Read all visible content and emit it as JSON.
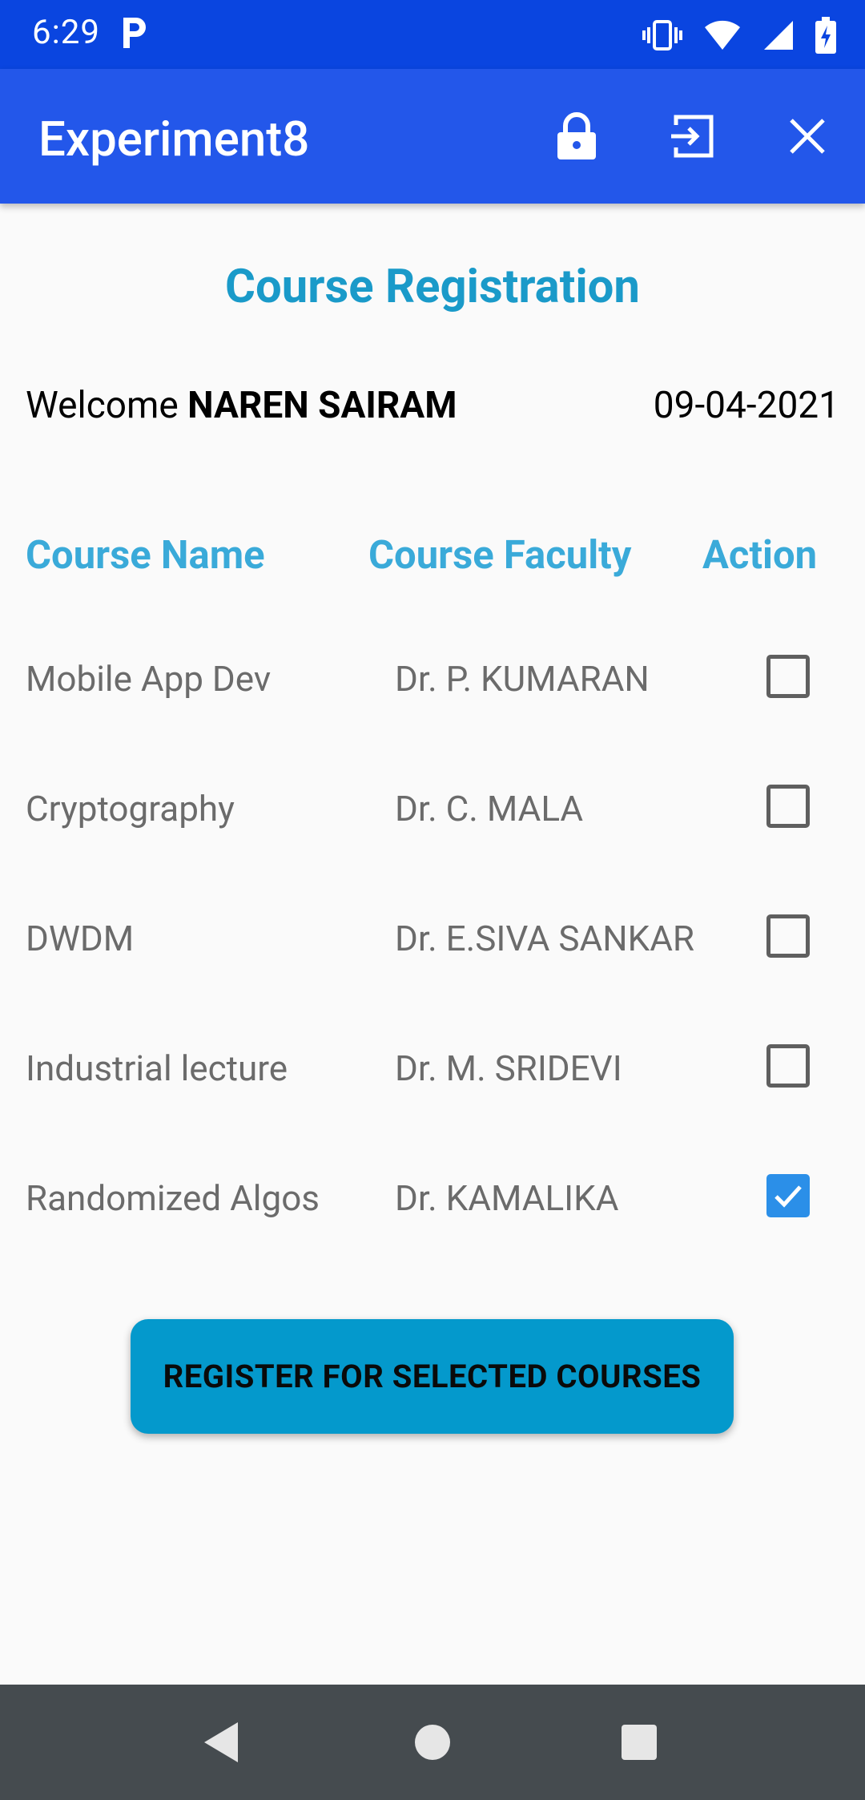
{
  "status_bar": {
    "time": "6:29",
    "icons": [
      "parking-p-icon",
      "vibrate-icon",
      "wifi-icon",
      "cell-signal-icon",
      "battery-charging-icon"
    ]
  },
  "app_bar": {
    "title": "Experiment8",
    "actions": [
      "lock-icon",
      "exit-icon",
      "close-icon"
    ]
  },
  "page": {
    "title": "Course Registration",
    "welcome_prefix": "Welcome ",
    "user_name": "NAREN SAIRAM",
    "date": "09-04-2021"
  },
  "table": {
    "headers": [
      "Course Name",
      "Course Faculty",
      "Action"
    ],
    "rows": [
      {
        "course": "Mobile App Dev",
        "faculty": "Dr. P. KUMARAN",
        "checked": false
      },
      {
        "course": "Cryptography",
        "faculty": "Dr. C. MALA",
        "checked": false
      },
      {
        "course": "DWDM",
        "faculty": "Dr. E.SIVA SANKAR",
        "checked": false
      },
      {
        "course": "Industrial lecture",
        "faculty": "Dr. M. SRIDEVI",
        "checked": false
      },
      {
        "course": "Randomized Algos",
        "faculty": "Dr. KAMALIKA",
        "checked": true
      }
    ]
  },
  "register_button": {
    "label": "REGISTER FOR SELECTED COURSES"
  },
  "colors": {
    "status_bar": "#0a45e0",
    "app_bar": "#2357ea",
    "title": "#1a9ac9",
    "header": "#3aaad9",
    "button": "#0499cc",
    "checkbox_checked": "#2b8fe8",
    "nav_bar": "#454b4f"
  }
}
